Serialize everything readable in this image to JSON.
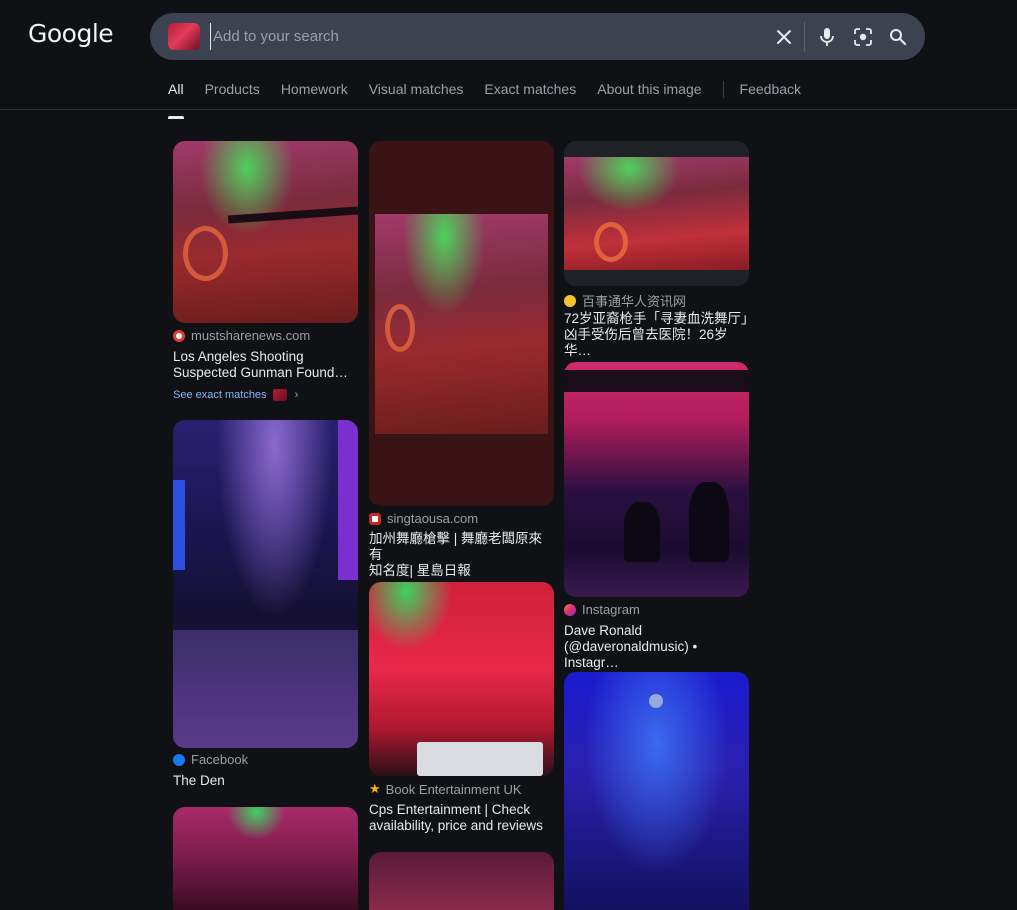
{
  "logo": "Google",
  "search": {
    "placeholder": "Add to your search"
  },
  "icons": {
    "clear": "close-icon",
    "voice": "microphone-icon",
    "lens": "lens-camera-icon",
    "search": "search-icon"
  },
  "tabs": [
    {
      "label": "All",
      "active": true
    },
    {
      "label": "Products"
    },
    {
      "label": "Homework"
    },
    {
      "label": "Visual matches"
    },
    {
      "label": "Exact matches"
    },
    {
      "label": "About this image"
    },
    {
      "label": "Feedback"
    }
  ],
  "results": [
    {
      "source": "mustsharenews.com",
      "title_1": "Los Angeles Shooting",
      "title_2": "Suspected Gunman Found…",
      "exact_label": "See exact matches"
    },
    {
      "source": "singtaousa.com",
      "title_1": "加州舞廳槍擊 | 舞廳老闆原來有",
      "title_2": "知名度| 星島日報"
    },
    {
      "source": "百事通华人资讯网",
      "title_1": "72岁亚裔枪手「寻妻血洗舞厅」",
      "title_2": "凶手受伤后曾去医院！26岁华…"
    },
    {
      "source": "Facebook",
      "title_1": "The Den"
    },
    {
      "source": "Book Entertainment UK",
      "title_1": "Cps Entertainment | Check",
      "title_2": "availability, price and reviews"
    },
    {
      "source": "Instagram",
      "title_1": "Dave Ronald",
      "title_2": "(@daveronaldmusic) • Instagr…"
    }
  ],
  "colors": {
    "background": "#0f1114",
    "searchbox": "#3d4250",
    "link": "#8ab4f8"
  }
}
